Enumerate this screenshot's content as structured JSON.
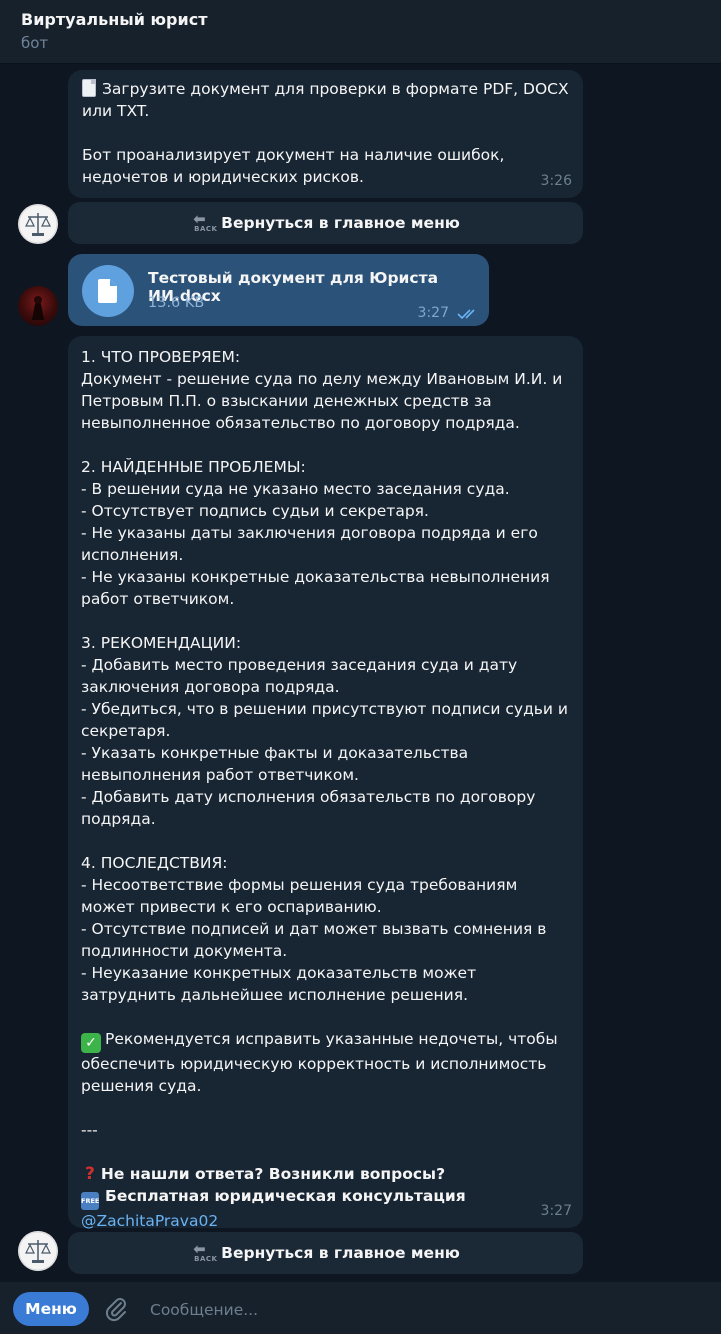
{
  "header": {
    "title": "Виртуальный юрист",
    "subtitle": "бот"
  },
  "messages": {
    "intro": {
      "line1": "Загрузите документ для проверки в формате PDF, DOCX или TXT.",
      "line2": "Бот проанализирует документ на наличие ошибок, недочетов и юридических рисков.",
      "time": "3:26"
    },
    "file": {
      "name": "Тестовый документ для Юриста ИИ.docx",
      "size": "13.6 KB",
      "time": "3:27"
    },
    "analysis": {
      "body": "1. ЧТО ПРОВЕРЯЕМ:\nДокумент - решение суда по делу между Ивановым И.И. и Петровым П.П. о взыскании денежных средств за невыполненное обязательство по договору подряда.\n\n2. НАЙДЕННЫЕ ПРОБЛЕМЫ:\n- В решении суда не указано место заседания суда.\n- Отсутствует подпись судьи и секретаря.\n- Не указаны даты заключения договора подряда и его исполнения.\n- Не указаны конкретные доказательства невыполнения работ ответчиком.\n\n3. РЕКОМЕНДАЦИИ:\n- Добавить место проведения заседания суда и дату заключения договора подряда.\n- Убедиться, что в решении присутствуют подписи судьи и секретаря.\n- Указать конкретные факты и доказательства невыполнения работ ответчиком.\n- Добавить дату исполнения обязательств по договору подряда.\n\n4. ПОСЛЕДСТВИЯ:\n- Несоответствие формы решения суда требованиям может привести к его оспариванию.\n- Отсутствие подписей и дат может вызвать сомнения в подлинности документа.\n- Неуказание конкретных доказательств может затруднить дальнейшее исполнение решения.",
      "recommendation": "Рекомендуется исправить указанные недочеты, чтобы обеспечить юридическую корректность и исполнимость решения суда.",
      "separator": "---",
      "question": "Не нашли ответа? Возникли вопросы?",
      "consult": "Бесплатная юридическая консультация",
      "link": "@ZachitaPrava02",
      "time": "3:27"
    }
  },
  "keyboard": {
    "back_label": "Вернуться в главное меню",
    "back_icon_text": "BACK"
  },
  "emoji": {
    "free_text": "FREE"
  },
  "bottom": {
    "menu_label": "Меню",
    "input_placeholder": "Сообщение..."
  }
}
